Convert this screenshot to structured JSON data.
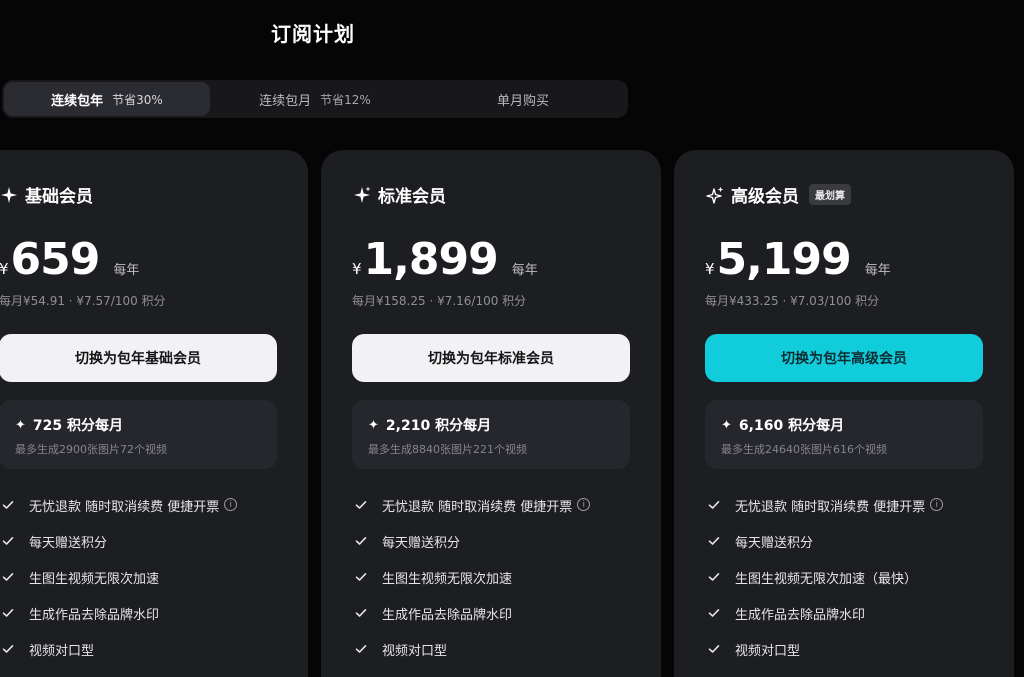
{
  "page": {
    "title": "订阅计划"
  },
  "billing_tabs": [
    {
      "label": "连续包年",
      "saving": "节省30%",
      "active": true
    },
    {
      "label": "连续包月",
      "saving": "节省12%",
      "active": false
    },
    {
      "label": "单月购买",
      "saving": "",
      "active": false
    }
  ],
  "colors": {
    "background": "#050506",
    "card": "#1d1e22",
    "accent": "#11cddb"
  },
  "plans": [
    {
      "icon": "sparkle-icon",
      "name": "基础会员",
      "badge": "",
      "currency": "¥",
      "price": "659",
      "period": "每年",
      "detail": "每月¥54.91 · ¥7.57/100 积分",
      "cta": "切换为包年基础会员",
      "credits": "725 积分每月",
      "credits_note": "最多生成2900张图片72个视频",
      "features": [
        "无忧退款 随时取消续费 便捷开票",
        "每天赠送积分",
        "生图生视频无限次加速",
        "生成作品去除品牌水印",
        "视频对口型"
      ]
    },
    {
      "icon": "sparkle-icon",
      "name": "标准会员",
      "badge": "",
      "currency": "¥",
      "price": "1,899",
      "period": "每年",
      "detail": "每月¥158.25 · ¥7.16/100 积分",
      "cta": "切换为包年标准会员",
      "credits": "2,210 积分每月",
      "credits_note": "最多生成8840张图片221个视频",
      "features": [
        "无忧退款 随时取消续费 便捷开票",
        "每天赠送积分",
        "生图生视频无限次加速",
        "生成作品去除品牌水印",
        "视频对口型"
      ]
    },
    {
      "icon": "sparkles-icon",
      "name": "高级会员",
      "badge": "最划算",
      "currency": "¥",
      "price": "5,199",
      "period": "每年",
      "detail": "每月¥433.25 · ¥7.03/100 积分",
      "cta": "切换为包年高级会员",
      "credits": "6,160 积分每月",
      "credits_note": "最多生成24640张图片616个视频",
      "features": [
        "无忧退款 随时取消续费 便捷开票",
        "每天赠送积分",
        "生图生视频无限次加速（最快）",
        "生成作品去除品牌水印",
        "视频对口型"
      ]
    }
  ]
}
